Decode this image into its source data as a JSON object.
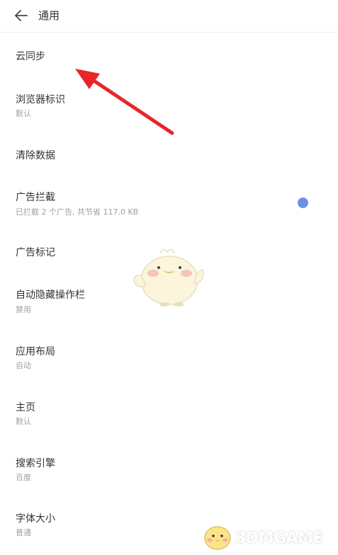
{
  "header": {
    "title": "通用",
    "back_icon": "arrow-left-icon"
  },
  "settings": [
    {
      "title": "云同步",
      "subtitle": ""
    },
    {
      "title": "浏览器标识",
      "subtitle": "默认"
    },
    {
      "title": "清除数据",
      "subtitle": ""
    },
    {
      "title": "广告拦截",
      "subtitle": "已拦截 2 个广告, 共节省 117.0 KB",
      "toggle_on": true
    },
    {
      "title": "广告标记",
      "subtitle": ""
    },
    {
      "title": "自动隐藏操作栏",
      "subtitle": "禁用"
    },
    {
      "title": "应用布局",
      "subtitle": "自动"
    },
    {
      "title": "主页",
      "subtitle": "默认"
    },
    {
      "title": "搜索引擎",
      "subtitle": "百度"
    },
    {
      "title": "字体大小",
      "subtitle": "普通"
    }
  ],
  "colors": {
    "accent": "#6f8fe6",
    "annotation_arrow": "#e8262a",
    "text_primary": "#333333",
    "text_secondary": "#a0a0a0"
  },
  "watermark": {
    "text": "3DMGAME"
  }
}
